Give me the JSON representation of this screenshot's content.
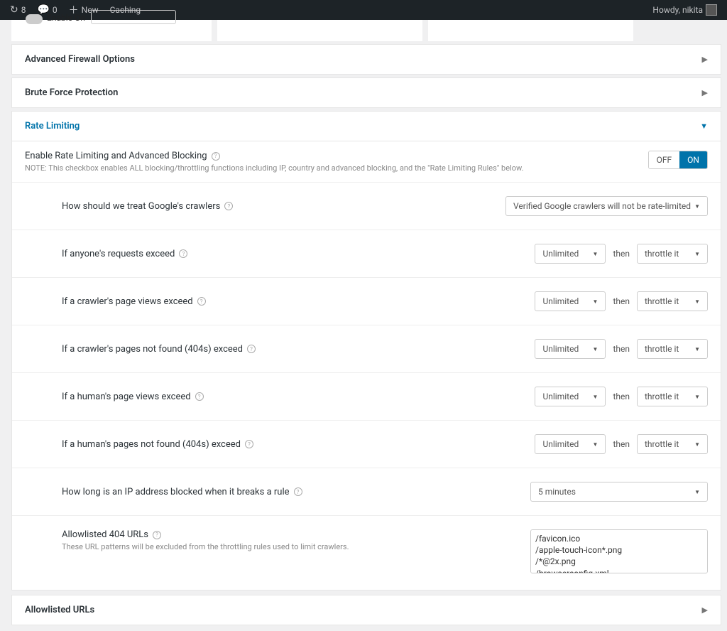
{
  "adminbar": {
    "updates_count": "8",
    "comments_count": "0",
    "new_label": "New",
    "caching_label": "Caching",
    "howdy": "Howdy, nikita"
  },
  "partial": {
    "enable_on": "Enable On"
  },
  "sections": {
    "advanced_firewall": "Advanced Firewall Options",
    "brute_force": "Brute Force Protection",
    "rate_limiting": "Rate Limiting",
    "allowlisted_urls": "Allowlisted URLs"
  },
  "rate_limit_enable": {
    "label": "Enable Rate Limiting and Advanced Blocking",
    "note": "NOTE: This checkbox enables ALL blocking/throttling functions including IP, country and advanced blocking, and the \"Rate Limiting Rules\" below.",
    "off": "OFF",
    "on": "ON"
  },
  "rules": {
    "google": {
      "label": "How should we treat Google's crawlers",
      "value": "Verified Google crawlers will not be rate-limited"
    },
    "then": "then",
    "unlimited": "Unlimited",
    "throttle": "throttle it",
    "r1": "If anyone's requests exceed",
    "r2": "If a crawler's page views exceed",
    "r3": "If a crawler's pages not found (404s) exceed",
    "r4": "If a human's page views exceed",
    "r5": "If a human's pages not found (404s) exceed",
    "block_label": "How long is an IP address blocked when it breaks a rule",
    "block_value": "5 minutes",
    "allow404_label": "Allowlisted 404 URLs",
    "allow404_sub": "These URL patterns will be excluded from the throttling rules used to limit crawlers.",
    "allow404_value": "/favicon.ico\n/apple-touch-icon*.png\n/*@2x.png\n/browserconfig.xml"
  }
}
